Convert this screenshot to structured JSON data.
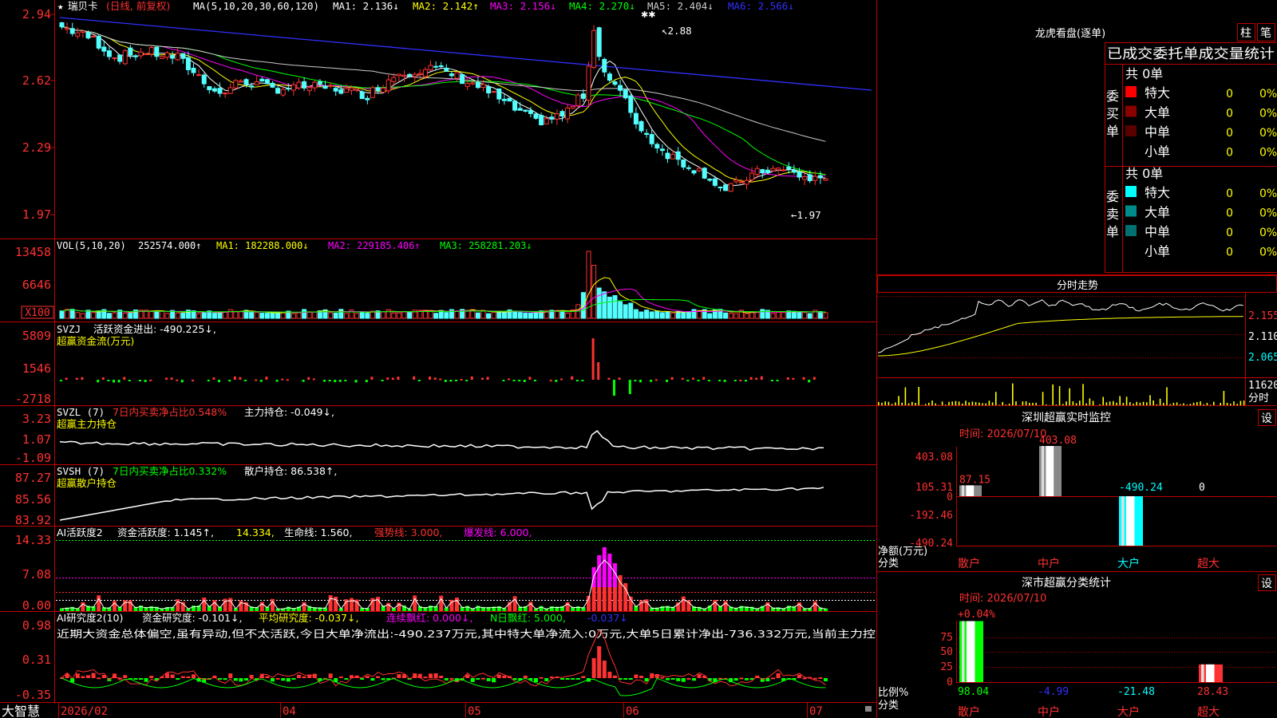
{
  "header": {
    "star": "★",
    "stock_name": "瑞贝卡",
    "period_label": "(日线, 前复权)",
    "ma_label": "MA(5,10,20,30,60,120)",
    "items": [
      {
        "text": "MA1: 2.136↓",
        "color": "#ffffff"
      },
      {
        "text": "MA2: 2.142↑",
        "color": "#ffff00"
      },
      {
        "text": "MA3: 2.156↓",
        "color": "#ff00ff"
      },
      {
        "text": "MA4: 2.270↓",
        "color": "#00ff00"
      },
      {
        "text": "MA5: 2.404↓",
        "color": "#cccccc"
      },
      {
        "text": "MA6: 2.566↓",
        "color": "#3030ff"
      }
    ]
  },
  "price_panel": {
    "y_labels": [
      "2.94",
      "2.62",
      "2.29",
      "1.97"
    ],
    "max_label": "2.88",
    "min_label": "1.97",
    "stars": "✱✱"
  },
  "vol_panel": {
    "title": "VOL(5,10,20)",
    "value": "252574.000↑",
    "items": [
      {
        "text": "MA1: 182288.000↓",
        "color": "#ffff00"
      },
      {
        "text": "MA2: 229185.406↑",
        "color": "#ff00ff"
      },
      {
        "text": "MA3: 258281.203↓",
        "color": "#00ff00"
      }
    ],
    "y_labels": [
      "13458",
      "6646"
    ],
    "unit": "X100"
  },
  "svzj_panel": {
    "title": "SVZJ",
    "line": "活跃资金进出: -490.225↓,",
    "sub": "超赢资金流(万元)",
    "y_labels": [
      "5809",
      "1546",
      "-2718"
    ]
  },
  "svzl_panel": {
    "title": "SVZL (7)",
    "pct": "7日内买卖净占比0.548%",
    "line": "主力持仓: -0.049↓,",
    "sub": "超赢主力持仓",
    "y_labels": [
      "3.23",
      "1.07",
      "-1.09"
    ]
  },
  "svsh_panel": {
    "title": "SVSH (7)",
    "pct": "7日内买卖净占比0.332%",
    "line": "散户持仓: 86.538↑,",
    "sub": "超赢散户持仓",
    "y_labels": [
      "87.27",
      "85.56",
      "83.92"
    ]
  },
  "ai_panel": {
    "title": "AI活跃度2",
    "items": [
      {
        "text": "资金活跃度: 1.145↑,",
        "color": "#ffffff"
      },
      {
        "text": "14.334,",
        "color": "#ffff00"
      },
      {
        "text": "生命线: 1.560,",
        "color": "#ffffff"
      },
      {
        "text": "强势线: 3.000,",
        "color": "#ff3030"
      },
      {
        "text": "爆发线: 6.000,",
        "color": "#ff00ff"
      }
    ],
    "y_labels": [
      "14.33",
      "7.08",
      "0.00"
    ]
  },
  "research_panel": {
    "title": "AI研究度2(10)",
    "items": [
      {
        "text": "资金研究度: -0.101↓,",
        "color": "#ffffff"
      },
      {
        "text": "平均研究度: -0.037↓,",
        "color": "#ffff00"
      },
      {
        "text": "连续飘红: 0.000↓,",
        "color": "#ff00ff"
      },
      {
        "text": "N日飘红: 5.000,",
        "color": "#00ff00"
      },
      {
        "text": "-0.037↓",
        "color": "#3030ff"
      }
    ],
    "text": "近期大资金总体偏空,虽有异动,但不太活跃,今日大单净流出:-490.237万元,其中特大单净流入:0万元,大单5日累计净出-736.332万元,当前主力控",
    "y_labels": [
      "0.98",
      "0.31",
      "-0.35"
    ]
  },
  "bottom_bar": {
    "brand": "大智慧",
    "dates": [
      "2026/02",
      "04",
      "05",
      "06",
      "07"
    ]
  },
  "right_panel": {
    "dragon_title": "龙虎看盘(逐单)",
    "btn_zhu": "柱",
    "btn_bi": "笔",
    "stats_title": "已成交委托单成交量统计",
    "buy_label": "委买单",
    "sell_label": "委卖单",
    "buy_total": "共 0单",
    "sell_total": "共 0单",
    "buy_rows": [
      {
        "name": "特大",
        "val": "0",
        "pct": "0%",
        "color": "#ff0000"
      },
      {
        "name": "大单",
        "val": "0",
        "pct": "0%",
        "color": "#8b0000"
      },
      {
        "name": "中单",
        "val": "0",
        "pct": "0%",
        "color": "#5a0000"
      },
      {
        "name": "小单",
        "val": "0",
        "pct": "0%",
        "color": ""
      }
    ],
    "sell_rows": [
      {
        "name": "特大",
        "val": "0",
        "pct": "0%",
        "color": "#00ffff"
      },
      {
        "name": "大单",
        "val": "0",
        "pct": "0%",
        "color": "#008b8b"
      },
      {
        "name": "中单",
        "val": "0",
        "pct": "0%",
        "color": "#007070"
      },
      {
        "name": "小单",
        "val": "0",
        "pct": "0%",
        "color": ""
      }
    ],
    "minute_title": "分时走势",
    "minute_prices": [
      "2.155",
      "2.110",
      "2.065"
    ],
    "minute_vol": "11620",
    "minute_vol_label": "分时",
    "sz_title": "深圳超赢实时监控",
    "sz_btn": "设",
    "sz_time": "时间: 2026/07/10",
    "sz_axis": [
      "403.08",
      "105.31",
      "0",
      "-192.46",
      "-490.24"
    ],
    "sz_net_label": "净额(万元)",
    "sz_cat_label": "分类",
    "sz_cats": [
      "散户",
      "中户",
      "大户",
      "超大"
    ],
    "sz_values": [
      "87.15",
      "403.08",
      "-490.24",
      "0"
    ],
    "fl_title": "深市超赢分类统计",
    "fl_btn": "设",
    "fl_time": "时间: 2026/07/10",
    "fl_top": "+0.04%",
    "fl_axis": [
      "75",
      "50",
      "25",
      "0"
    ],
    "fl_ratio_label": "比例%",
    "fl_cat_label": "分类",
    "fl_cats": [
      "散户",
      "中户",
      "大户",
      "超大"
    ],
    "fl_values": [
      "98.04",
      "-4.99",
      "-21.48",
      "28.43"
    ]
  },
  "colors": {
    "up": "#ff3232",
    "down": "#54ffff",
    "grid": "#c00000",
    "label": "#ff4040",
    "green": "#00ff00"
  },
  "chart_data": [
    {
      "type": "candlestick",
      "title": "瑞贝卡 (日线, 前复权)",
      "y_ticks": [
        2.94,
        2.62,
        2.29,
        1.97
      ],
      "ylim": [
        1.94,
        3.0
      ],
      "x_labels": [
        "2026/02",
        "04",
        "05",
        "06",
        "07"
      ],
      "series": [
        {
          "name": "MA1",
          "last": 2.136
        },
        {
          "name": "MA2",
          "last": 2.142
        },
        {
          "name": "MA3",
          "last": 2.156
        },
        {
          "name": "MA4",
          "last": 2.27
        },
        {
          "name": "MA5",
          "last": 2.404
        },
        {
          "name": "MA6",
          "last": 2.566
        }
      ],
      "annotations": [
        {
          "label": "2.88",
          "type": "max"
        },
        {
          "label": "1.97",
          "type": "min"
        }
      ]
    },
    {
      "type": "bar",
      "title": "VOL(5,10,20)",
      "last": 252574.0,
      "y_ticks": [
        13458,
        6646
      ],
      "unit": "X100"
    },
    {
      "type": "bar",
      "title": "SVZJ 超赢资金流(万元)",
      "last": -490.225,
      "y_ticks": [
        5809,
        1546,
        -2718
      ]
    },
    {
      "type": "line",
      "title": "SVZL (7) 超赢主力持仓",
      "last": -0.049,
      "y_ticks": [
        3.23,
        1.07,
        -1.09
      ]
    },
    {
      "type": "line",
      "title": "SVSH (7) 超赢散户持仓",
      "last": 86.538,
      "y_ticks": [
        87.27,
        85.56,
        83.92
      ]
    },
    {
      "type": "bar",
      "title": "AI活跃度2",
      "last": 1.145,
      "y_ticks": [
        14.33,
        7.08,
        0.0
      ]
    },
    {
      "type": "bar",
      "title": "AI研究度2(10)",
      "last": -0.101,
      "y_ticks": [
        0.98,
        0.31,
        -0.35
      ]
    },
    {
      "type": "bar",
      "title": "深圳超赢实时监控",
      "categories": [
        "散户",
        "中户",
        "大户",
        "超大"
      ],
      "values": [
        87.15,
        403.08,
        -490.24,
        0
      ],
      "ylim": [
        -490.24,
        403.08
      ]
    },
    {
      "type": "bar",
      "title": "深市超赢分类统计",
      "categories": [
        "散户",
        "中户",
        "大户",
        "超大"
      ],
      "values": [
        98.04,
        -4.99,
        -21.48,
        28.43
      ],
      "ylim": [
        0,
        100
      ]
    }
  ]
}
